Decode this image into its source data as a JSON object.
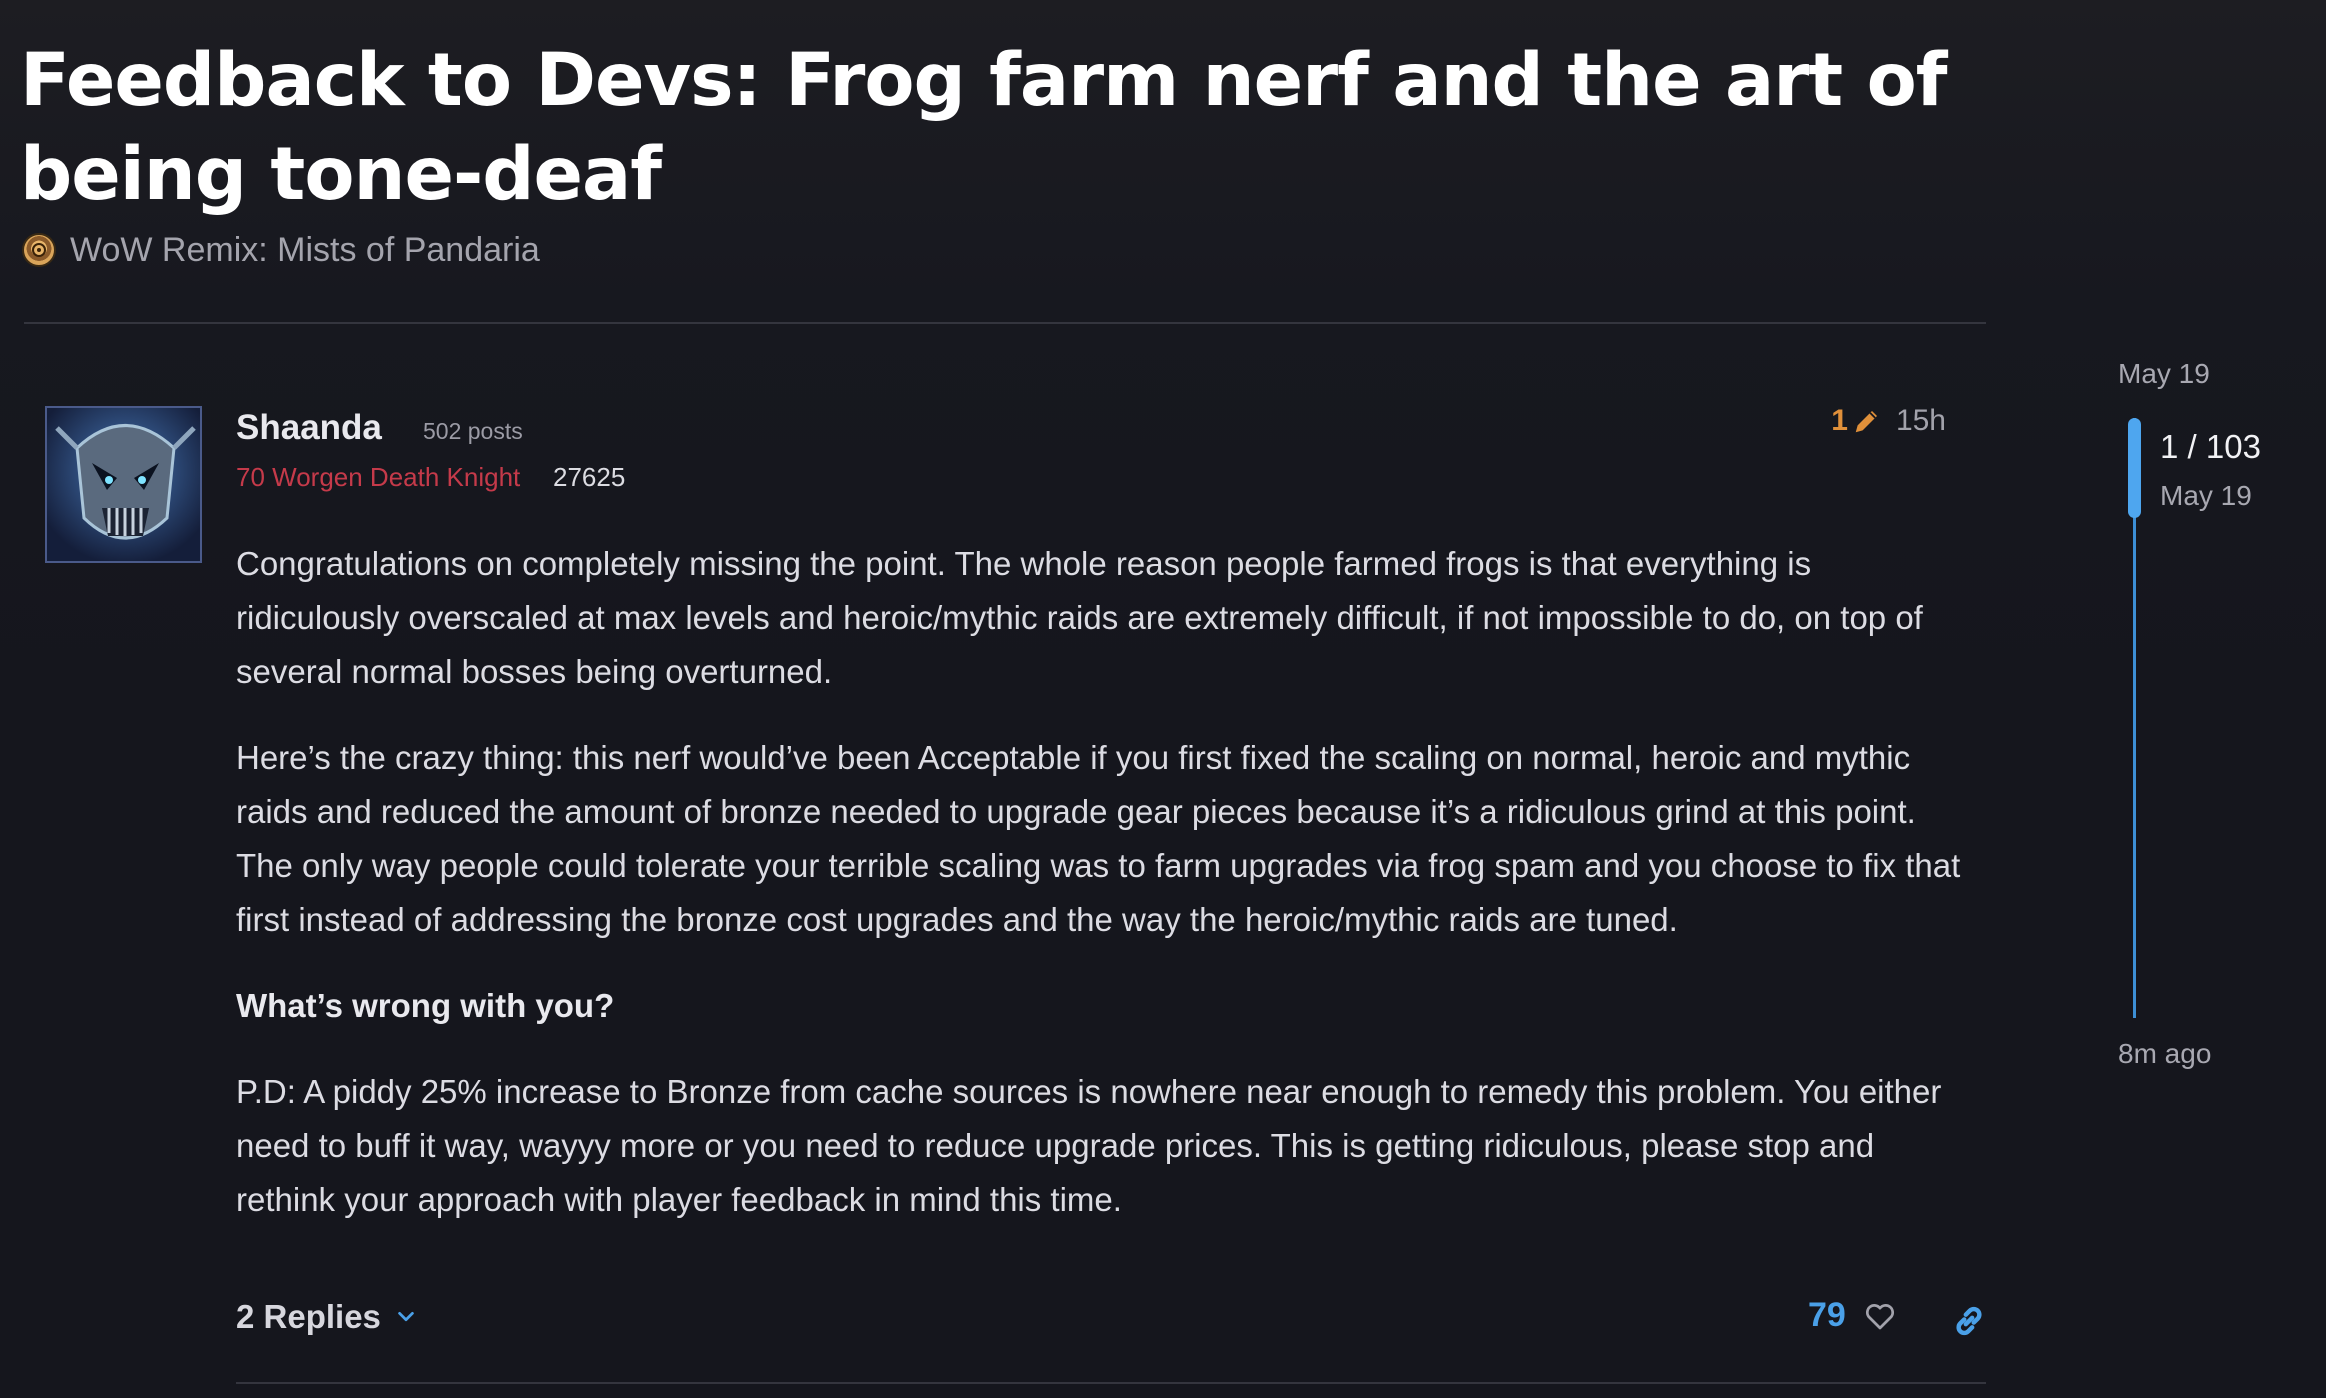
{
  "topic": {
    "title": "Feedback to Devs: Frog farm nerf and the art of being tone-deaf",
    "category": "WoW Remix: Mists of Pandaria"
  },
  "post": {
    "username": "Shaanda",
    "post_count": "502 posts",
    "user_title": "70 Worgen Death Knight",
    "achievement_points": "27625",
    "edit_count": "1",
    "time": "15h",
    "paragraphs": [
      "Congratulations on completely missing the point. The whole reason people farmed frogs is that everything is ridiculously overscaled at max levels and heroic/mythic raids are extremely difficult, if not impossible to do, on top of several normal bosses being overturned.",
      "Here’s the crazy thing: this nerf would’ve been Acceptable if you first fixed the scaling on normal, heroic and mythic raids and reduced the amount of bronze needed to upgrade gear pieces because it’s a ridiculous grind at this point. The only way people could tolerate your terrible scaling was to farm upgrades via frog spam and you choose to fix that first instead of addressing the bronze cost upgrades and the way the heroic/mythic raids are tuned.",
      "What’s wrong with you?",
      "P.D: A piddy 25% increase to Bronze from cache sources is nowhere near enough to remedy this problem. You either need to buff it way, wayyy more or you need to reduce upgrade prices. This is getting ridiculous, please stop and rethink your approach with player feedback in mind this time."
    ],
    "replies_label": "2 Replies",
    "like_count": "79"
  },
  "timeline": {
    "start_date": "May 19",
    "position": "1 / 103",
    "position_date": "May 19",
    "end_label": "8m ago"
  },
  "icons": {
    "category": "category-emblem-icon",
    "edit": "pencil-icon",
    "replies_toggle": "chevron-down-icon",
    "like": "heart-icon",
    "share": "link-icon"
  },
  "colors": {
    "background": "#15161d",
    "accent": "#4aa0e8",
    "user_title": "#c53a4a",
    "edit": "#e0903a"
  }
}
